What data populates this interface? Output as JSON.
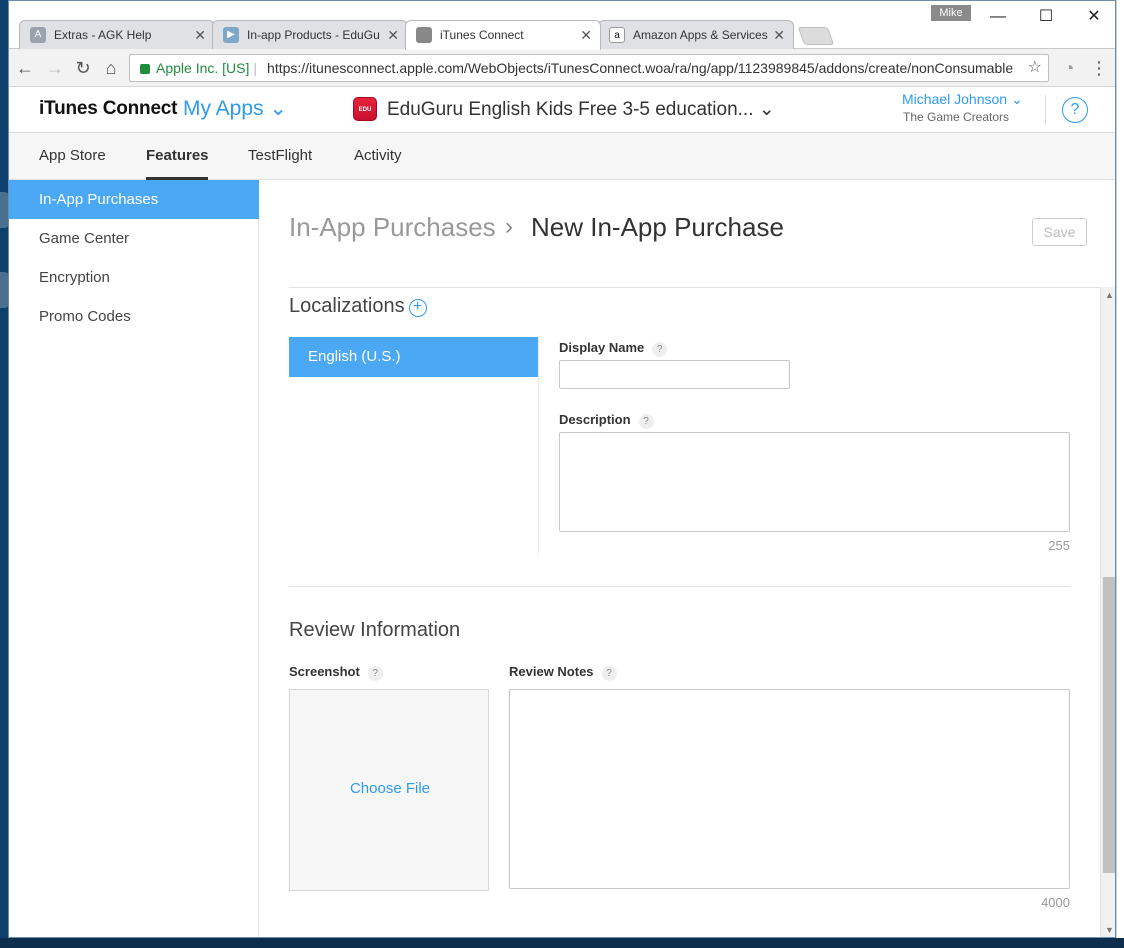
{
  "browser": {
    "tabs": [
      {
        "title": "Extras - AGK Help",
        "favicon": "agk-favicon",
        "active": false
      },
      {
        "title": "In-app Products - EduGu",
        "favicon": "play-console-favicon",
        "active": false
      },
      {
        "title": "iTunes Connect",
        "favicon": "apple-favicon",
        "active": true
      },
      {
        "title": "Amazon Apps & Services",
        "favicon": "amazon-favicon",
        "active": false
      }
    ],
    "close_glyph": "✕",
    "profile_name": "Mike",
    "secure_label": "Apple Inc. [US]",
    "url": "https://itunesconnect.apple.com/WebObjects/iTunesConnect.woa/ra/ng/app/1123989845/addons/create/nonConsumable"
  },
  "header": {
    "brand": "iTunes Connect",
    "my_apps": "My Apps ⌄",
    "app_name": "EduGuru English Kids Free 3-5 education... ⌄",
    "user_name": "Michael Johnson ⌄",
    "org_name": "The Game Creators",
    "help_glyph": "?"
  },
  "subnav": {
    "items": [
      "App Store",
      "Features",
      "TestFlight",
      "Activity"
    ],
    "active": "Features"
  },
  "sidebar": {
    "items": [
      "In-App Purchases",
      "Game Center",
      "Encryption",
      "Promo Codes"
    ],
    "active": "In-App Purchases"
  },
  "page": {
    "breadcrumb_parent": "In-App Purchases",
    "breadcrumb_sep": "›",
    "breadcrumb_current": "New In-App Purchase",
    "save_label": "Save"
  },
  "localizations": {
    "title": "Localizations",
    "active_locale": "English (U.S.)",
    "display_name_label": "Display Name",
    "display_name_value": "",
    "description_label": "Description",
    "description_value": "",
    "description_limit": "255"
  },
  "review": {
    "title": "Review Information",
    "screenshot_label": "Screenshot",
    "choose_file": "Choose File",
    "notes_label": "Review Notes",
    "notes_value": "",
    "notes_limit": "4000"
  },
  "colors": {
    "accent": "#2e9af0",
    "selected_bg": "#4aa8f5",
    "secure_green": "#1e8e3e"
  }
}
